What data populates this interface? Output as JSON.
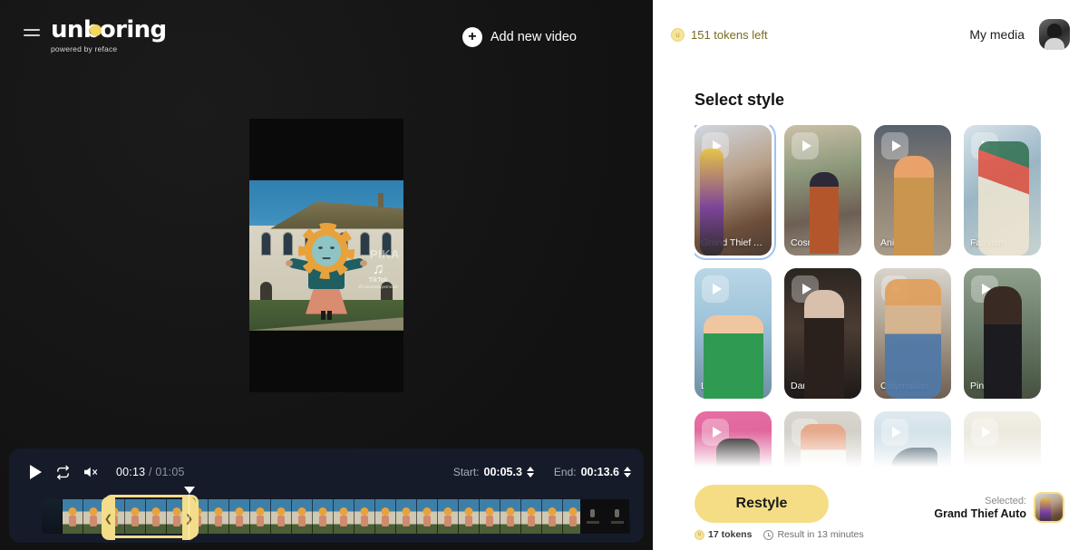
{
  "editor": {
    "menu_icon": "hamburger-icon",
    "logo": {
      "word": "unboring",
      "subtitle": "powered by reface"
    },
    "add_video_label": "Add new video",
    "add_video_icon": "plus-icon",
    "video": {
      "watermark_brand": "TikTok",
      "watermark_handle": "@ monoscarpetmusic",
      "watermark_secondary": "PIKA"
    },
    "player": {
      "play_icon": "play-icon",
      "loop_icon": "loop-icon",
      "mute_icon": "volume-muted-icon",
      "current_time": "00:13",
      "separator": "/",
      "total_time": "01:05",
      "start_label": "Start:",
      "start_value": "00:05.3",
      "end_label": "End:",
      "end_value": "00:13.6",
      "trim_left_icon": "chevron-left-icon",
      "trim_right_icon": "chevron-right-icon"
    }
  },
  "panel": {
    "tokens_left": "151 tokens left",
    "token_icon_glyph": "u",
    "my_media_label": "My media",
    "avatar_name": "user-avatar",
    "title": "Select style",
    "styles": [
      {
        "label": "Grand Thief A…",
        "art": "art1",
        "selected": true
      },
      {
        "label": "Cosmic",
        "art": "art2",
        "selected": false
      },
      {
        "label": "Anime",
        "art": "art3",
        "selected": false
      },
      {
        "label": "Fauvism",
        "art": "art4",
        "selected": false
      },
      {
        "label": "L3GO",
        "art": "art5",
        "selected": false
      },
      {
        "label": "Dark",
        "art": "art6",
        "selected": false
      },
      {
        "label": "Claymation",
        "art": "art7",
        "selected": false
      },
      {
        "label": "Pin Up",
        "art": "art8",
        "selected": false
      },
      {
        "label": "",
        "art": "art9",
        "selected": false
      },
      {
        "label": "",
        "art": "art10",
        "selected": false
      },
      {
        "label": "",
        "art": "art11",
        "selected": false
      },
      {
        "label": "",
        "art": "art12",
        "selected": false
      }
    ],
    "action": {
      "restyle_label": "Restyle",
      "cost_label": "17 tokens",
      "eta_label": "Result in 13 minutes",
      "selected_label": "Selected:",
      "selected_style": "Grand Thief Auto"
    }
  },
  "colors": {
    "accent_yellow": "#f5dd85",
    "selection_blue": "#9dc3f0",
    "editor_bg": "#151515",
    "player_bg": "#161b29",
    "panel_bg": "#ffffff"
  }
}
